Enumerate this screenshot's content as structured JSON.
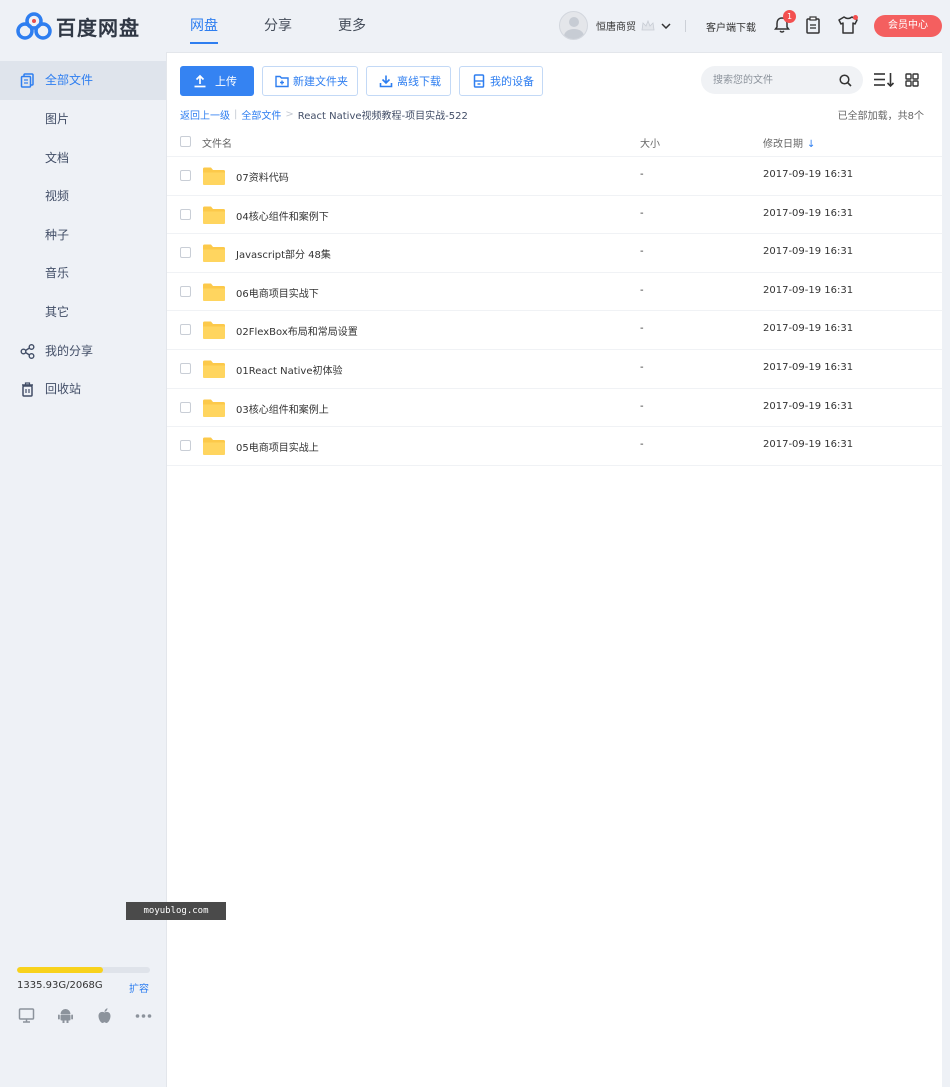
{
  "app": {
    "name": "百度网盘"
  },
  "nav": [
    {
      "label": "网盘",
      "active": true
    },
    {
      "label": "分享",
      "active": false
    },
    {
      "label": "更多",
      "active": false
    }
  ],
  "user": {
    "name": "恒唐商贸",
    "client_download": "客户端下载",
    "notification_count": "1",
    "vip_center": "会员中心"
  },
  "sidebar": {
    "items": [
      {
        "label": "全部文件",
        "icon": "file-icon",
        "active": true
      },
      {
        "label": "图片"
      },
      {
        "label": "文档"
      },
      {
        "label": "视频"
      },
      {
        "label": "种子"
      },
      {
        "label": "音乐"
      },
      {
        "label": "其它"
      },
      {
        "label": "我的分享",
        "icon": "share-icon"
      },
      {
        "label": "回收站",
        "icon": "trash-icon"
      }
    ],
    "quota": {
      "text": "1335.93G/2068G",
      "used_fraction": 0.646,
      "expand": "扩容"
    }
  },
  "toolbar": {
    "upload": "上传",
    "new_folder": "新建文件夹",
    "offline_download": "离线下载",
    "my_devices": "我的设备",
    "search_placeholder": "搜索您的文件"
  },
  "breadcrumb": {
    "back": "返回上一级",
    "all_files": "全部文件",
    "current": "React Native视频教程-项目实战-522",
    "status": "已全部加载，共8个"
  },
  "table": {
    "columns": {
      "name": "文件名",
      "size": "大小",
      "date": "修改日期"
    },
    "rows": [
      {
        "name": "07资料代码",
        "size": "-",
        "date": "2017-09-19 16:31"
      },
      {
        "name": "04核心组件和案例下",
        "size": "-",
        "date": "2017-09-19 16:31"
      },
      {
        "name": "Javascript部分 48集",
        "size": "-",
        "date": "2017-09-19 16:31"
      },
      {
        "name": "06电商项目实战下",
        "size": "-",
        "date": "2017-09-19 16:31"
      },
      {
        "name": "02FlexBox布局和常局设置",
        "size": "-",
        "date": "2017-09-19 16:31"
      },
      {
        "name": "01React Native初体验",
        "size": "-",
        "date": "2017-09-19 16:31"
      },
      {
        "name": "03核心组件和案例上",
        "size": "-",
        "date": "2017-09-19 16:31"
      },
      {
        "name": "05电商项目实战上",
        "size": "-",
        "date": "2017-09-19 16:31"
      }
    ]
  },
  "watermark": "moyublog.com",
  "colors": {
    "accent": "#2e7ef0",
    "vip": "#f45f5f",
    "folder": "#fcc94a",
    "quota": "#f8d21c"
  }
}
